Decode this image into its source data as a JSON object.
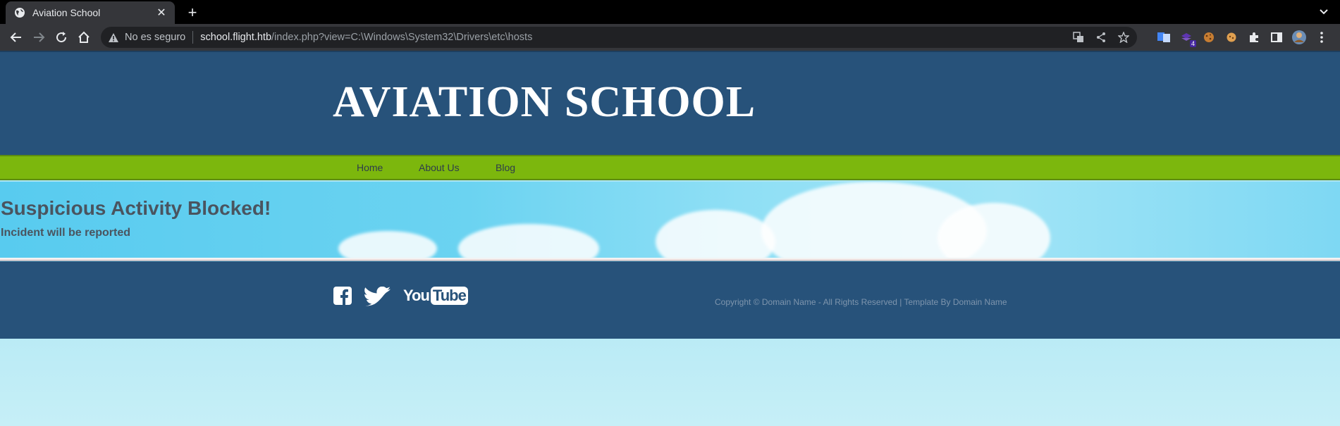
{
  "browser": {
    "tab_title": "Aviation School",
    "new_tab_symbol": "+",
    "close_symbol": "✕",
    "security_label": "No es seguro",
    "url_host": "school.flight.htb",
    "url_path": "/index.php?view=C:\\Windows\\System32\\Drivers\\etc\\hosts",
    "extension_badge": "4"
  },
  "site": {
    "title": "AVIATION SCHOOL",
    "nav": [
      {
        "label": "Home"
      },
      {
        "label": "About Us"
      },
      {
        "label": "Blog"
      }
    ],
    "hero": {
      "title": "Suspicious Activity Blocked!",
      "subtitle": "Incident will be reported"
    },
    "footer": {
      "social": [
        "facebook-icon",
        "twitter-icon",
        "youtube-icon"
      ],
      "youtube_text_you": "You",
      "youtube_text_tube": "Tube",
      "copyright": "Copyright © Domain Name - All Rights Reserved | Template By Domain Name"
    }
  },
  "colors": {
    "header_bg": "#27527a",
    "nav_bg": "#7cb70d",
    "hero_text": "#4a545f",
    "chrome_bg": "#35363a"
  }
}
